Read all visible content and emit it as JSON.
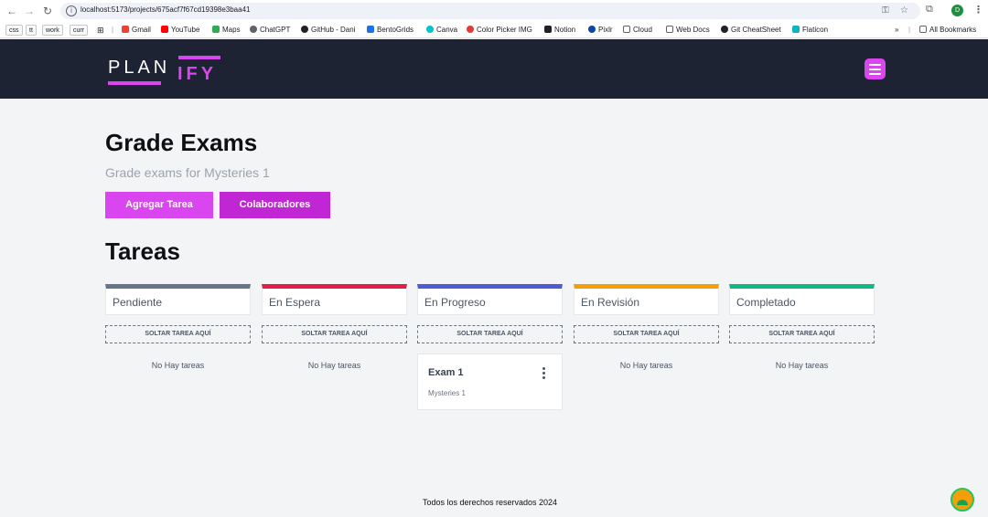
{
  "browser": {
    "url": "localhost:5173/projects/675acf7f67cd19398e3baa41",
    "nav": {
      "back": "←",
      "forward": "→",
      "reload": "↻"
    },
    "icons": {
      "key": "⚿",
      "star": "☆",
      "extensions": "⧉",
      "menu": "⋮"
    },
    "profile_initial": "D",
    "bookmarks": [
      {
        "label": "css",
        "kind": "tag"
      },
      {
        "label": "tt",
        "kind": "tag"
      },
      {
        "label": "work",
        "kind": "tag"
      },
      {
        "label": "curr",
        "kind": "tag"
      },
      {
        "label": "Gmail",
        "icon": "gmail-icon",
        "color": "#ea4335"
      },
      {
        "label": "YouTube",
        "icon": "youtube-icon",
        "color": "#ff0000"
      },
      {
        "label": "Maps",
        "icon": "maps-icon",
        "color": "#34a853"
      },
      {
        "label": "ChatGPT",
        "icon": "chatgpt-icon",
        "color": "#5f6368"
      },
      {
        "label": "GitHub - Dani",
        "icon": "github-icon",
        "color": "#202124"
      },
      {
        "label": "BentoGrids",
        "icon": "bentogrids-icon",
        "color": "#1a73e8"
      },
      {
        "label": "Canva",
        "icon": "canva-icon",
        "color": "#00c4cc"
      },
      {
        "label": "Color Picker IMG",
        "icon": "colorpicker-icon",
        "color": "#e53935"
      },
      {
        "label": "Notion",
        "icon": "notion-icon",
        "color": "#202124"
      },
      {
        "label": "Pixlr",
        "icon": "pixlr-icon",
        "color": "#0d47a1"
      },
      {
        "label": "Cloud",
        "icon": "folder-icon",
        "color": "#5f6368"
      },
      {
        "label": "Web Docs",
        "icon": "folder-icon",
        "color": "#5f6368"
      },
      {
        "label": "Git CheatSheet",
        "icon": "github-icon",
        "color": "#202124"
      },
      {
        "label": "Flaticon",
        "icon": "flaticon-icon",
        "color": "#0fb4b9"
      }
    ],
    "more_bookmarks": "»",
    "all_bookmarks": "All Bookmarks"
  },
  "header": {
    "logo_main": "PLAN",
    "logo_accent": "IFY",
    "accent_color": "#d946ef",
    "bg_color": "#1e2333"
  },
  "project": {
    "title": "Grade Exams",
    "description": "Grade exams for Mysteries 1",
    "add_task_label": "Agregar Tarea",
    "collaborators_label": "Colaboradores"
  },
  "tasks_heading": "Tareas",
  "drop_label": "SOLTAR TAREA AQUÍ",
  "empty_label": "No Hay tareas",
  "columns": [
    {
      "title": "Pendiente",
      "color": "#64748b"
    },
    {
      "title": "En Espera",
      "color": "#e11d48"
    },
    {
      "title": "En Progreso",
      "color": "#4f5bd5"
    },
    {
      "title": "En Revisión",
      "color": "#f59e0b"
    },
    {
      "title": "Completado",
      "color": "#10b981"
    }
  ],
  "tasks": [
    {
      "column": 2,
      "title": "Exam 1",
      "description": "Mysteries 1"
    }
  ],
  "footer": "Todos los derechos reservados 2024"
}
